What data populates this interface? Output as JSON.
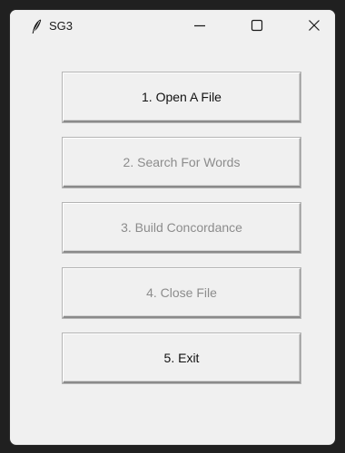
{
  "window": {
    "title": "SG3",
    "app_icon": "feather-icon",
    "controls": {
      "minimize_icon": "minimize-icon",
      "maximize_icon": "maximize-icon",
      "close_icon": "close-icon"
    }
  },
  "buttons": [
    {
      "label": "1. Open A File",
      "enabled": true
    },
    {
      "label": "2. Search For Words",
      "enabled": false
    },
    {
      "label": "3. Build Concordance",
      "enabled": false
    },
    {
      "label": "4. Close File",
      "enabled": false
    },
    {
      "label": "5. Exit",
      "enabled": true
    }
  ],
  "colors": {
    "background": "#f0f0f0",
    "enabled_text": "#111111",
    "disabled_text": "#8c8c8c"
  }
}
